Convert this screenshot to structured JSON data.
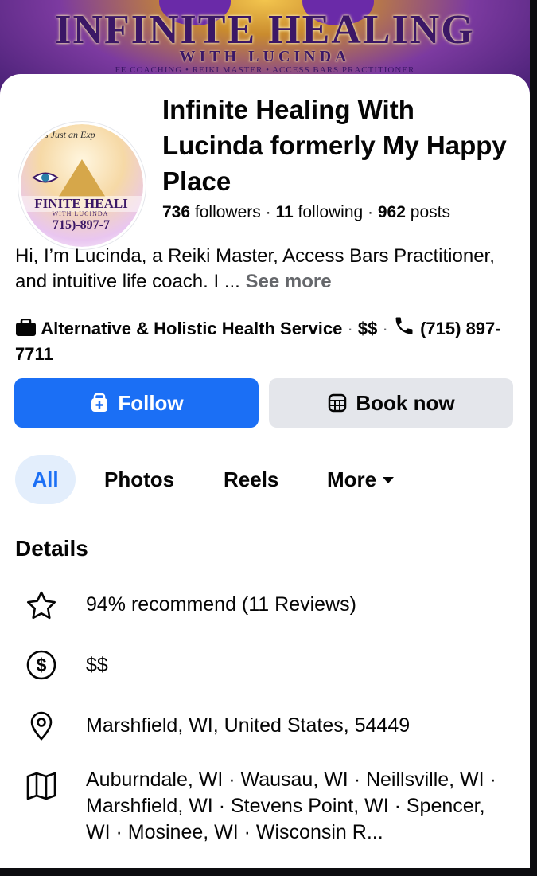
{
  "cover": {
    "title": "INFINITE HEALING",
    "subtitle": "WITH LUCINDA",
    "services_line": "FE COACHING • REIKI MASTER • ACCESS BARS PRACTITIONER"
  },
  "avatar": {
    "script_text": "Is Just an Exp",
    "title_text": "FINITE HEALI",
    "with_text": "WITH LUCINDA",
    "phone_text": "715)-897-7"
  },
  "profile": {
    "name": "Infinite Healing With Lucinda formerly My Happy Place",
    "followers_count": "736",
    "followers_label": "followers",
    "following_count": "11",
    "following_label": "following",
    "posts_count": "962",
    "posts_label": "posts",
    "separator": " · "
  },
  "bio": {
    "text": "Hi, I’m Lucinda, a Reiki Master, Access Bars Practitioner, and intuitive life coach. I ...",
    "see_more": "See more"
  },
  "category": {
    "name": "Alternative & Holistic Health Service",
    "price": "$$",
    "phone": "(715) 897-7711",
    "icon_category": "briefcase-icon",
    "icon_phone": "phone-icon"
  },
  "actions": {
    "follow_label": "Follow",
    "book_label": "Book now"
  },
  "tabs": {
    "all": "All",
    "photos": "Photos",
    "reels": "Reels",
    "more": "More"
  },
  "details": {
    "heading": "Details",
    "recommend": "94% recommend (11 Reviews)",
    "price": "$$",
    "address": "Marshfield, WI, United States, 54449",
    "service_area": "Auburndale, WI · Wausau, WI · Neillsville, WI · Marshfield, WI · Stevens Point, WI · Spencer, WI · Mosinee, WI · Wisconsin R..."
  },
  "colors": {
    "accent": "#1b6ff5",
    "secondary_button": "#e4e6eb",
    "muted_text": "#65676b"
  }
}
